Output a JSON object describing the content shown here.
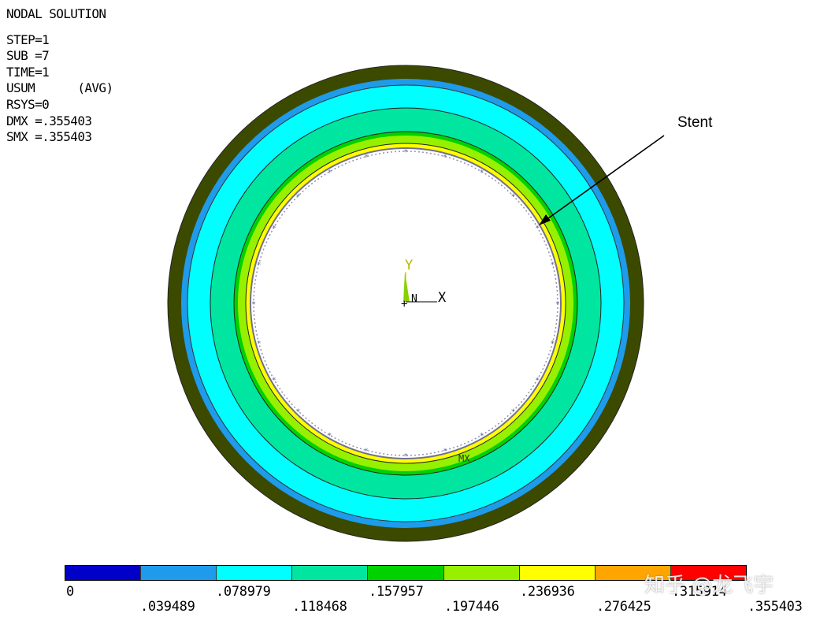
{
  "info": {
    "title": "NODAL SOLUTION",
    "step": "STEP=1",
    "sub": "SUB =7",
    "time": "TIME=1",
    "usum": "USUM      (AVG)",
    "rsys": "RSYS=0",
    "dmx": "DMX =.355403",
    "smx": "SMX =.355403"
  },
  "annotations": {
    "stent": "Stent",
    "mx": "MX",
    "axis_y": "Y",
    "axis_x": "X",
    "node": "N"
  },
  "legend": {
    "colors": [
      "#0000c8",
      "#1e9bea",
      "#00ffff",
      "#00e6a0",
      "#00d200",
      "#96f000",
      "#ffff00",
      "#ffa500",
      "#ff0000"
    ],
    "upper_labels": [
      "0",
      ".078979",
      ".157957",
      ".236936",
      ".315914"
    ],
    "lower_labels": [
      ".039489",
      ".118468",
      ".197446",
      ".276425",
      ".355403"
    ]
  },
  "rings": {
    "colors": [
      "#3c4a00",
      "#1e9bea",
      "#00ffff",
      "#00e6a0",
      "#00d200",
      "#96f000",
      "#ffff00",
      "#ffffff"
    ]
  },
  "watermark": "知乎 @龙飞宇"
}
